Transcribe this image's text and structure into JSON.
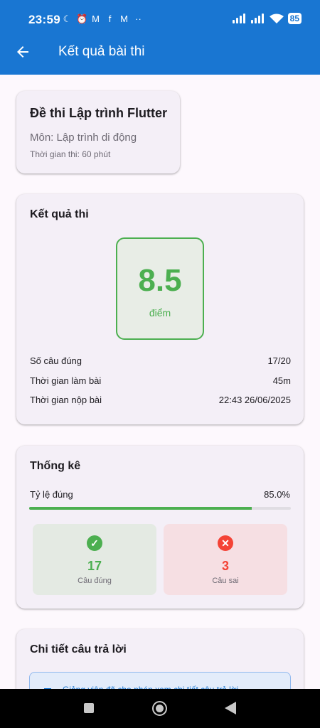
{
  "status_bar": {
    "time": "23:59",
    "notification_icons": [
      "moon-icon",
      "alarm-icon",
      "gmail-icon",
      "facebook-icon",
      "gmail-icon",
      "more-dots-icon"
    ],
    "battery": "85"
  },
  "app_bar": {
    "title": "Kết quả bài thi",
    "back_icon": "arrow-back-icon",
    "color": "#1976d2"
  },
  "exam_info": {
    "title": "Đề thi Lập trình Flutter",
    "subject": "Môn: Lập trình di động",
    "duration": "Thời gian thi: 60 phút"
  },
  "result": {
    "section_title": "Kết quả thi",
    "score": "8.5",
    "score_unit": "điểm",
    "rows": [
      {
        "label": "Số câu đúng",
        "value": "17/20"
      },
      {
        "label": "Thời gian làm bài",
        "value": "45m"
      },
      {
        "label": "Thời gian nộp bài",
        "value": "22:43 26/06/2025"
      }
    ]
  },
  "statistics": {
    "section_title": "Thống kê",
    "rate_label": "Tỷ lệ đúng",
    "rate_value": "85.0%",
    "rate_fraction": 0.85,
    "correct": {
      "count": "17",
      "label": "Câu đúng",
      "icon": "check-circle-icon",
      "color": "#4caf50"
    },
    "wrong": {
      "count": "3",
      "label": "Câu sai",
      "icon": "cancel-circle-icon",
      "color": "#f44336"
    }
  },
  "answer_details": {
    "section_title": "Chi tiết câu trả lời",
    "note": "Giảng viên đã cho phép xem chi tiết câu trả lời"
  },
  "nav_bar": {
    "buttons": [
      "recents-icon",
      "home-icon",
      "back-icon"
    ]
  }
}
